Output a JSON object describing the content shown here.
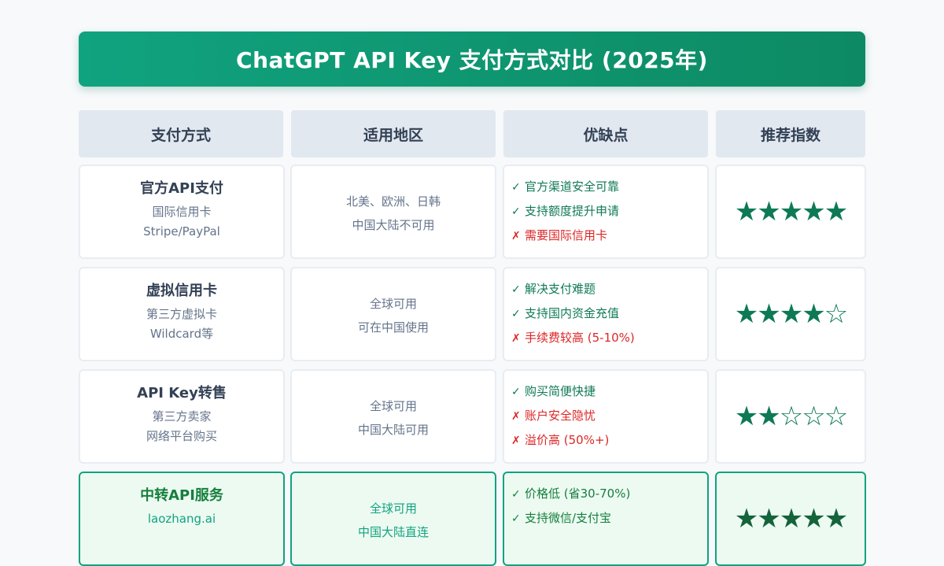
{
  "title": "ChatGPT API Key 支付方式对比 (2025年)",
  "headers": [
    "支付方式",
    "适用地区",
    "优缺点",
    "推荐指数"
  ],
  "rows": [
    {
      "method": {
        "name": "官方API支付",
        "lines": [
          "国际信用卡",
          "Stripe/PayPal"
        ]
      },
      "region": [
        "北美、欧洲、日韩",
        "中国大陆不可用"
      ],
      "points": [
        {
          "type": "pro",
          "mark": "✓",
          "text": "官方渠道安全可靠"
        },
        {
          "type": "pro",
          "mark": "✓",
          "text": "支持额度提升申请"
        },
        {
          "type": "con",
          "mark": "✗",
          "text": "需要国际信用卡"
        }
      ],
      "stars": "★★★★★",
      "highlight": false
    },
    {
      "method": {
        "name": "虚拟信用卡",
        "lines": [
          "第三方虚拟卡",
          "Wildcard等"
        ]
      },
      "region": [
        "全球可用",
        "可在中国使用"
      ],
      "points": [
        {
          "type": "pro",
          "mark": "✓",
          "text": "解决支付难题"
        },
        {
          "type": "pro",
          "mark": "✓",
          "text": "支持国内资金充值"
        },
        {
          "type": "con",
          "mark": "✗",
          "text": "手续费较高 (5-10%)"
        }
      ],
      "stars": "★★★★☆",
      "highlight": false
    },
    {
      "method": {
        "name": "API Key转售",
        "lines": [
          "第三方卖家",
          "网络平台购买"
        ]
      },
      "region": [
        "全球可用",
        "中国大陆可用"
      ],
      "points": [
        {
          "type": "pro",
          "mark": "✓",
          "text": "购买简便快捷"
        },
        {
          "type": "con",
          "mark": "✗",
          "text": "账户安全隐忧"
        },
        {
          "type": "con",
          "mark": "✗",
          "text": "溢价高 (50%+)"
        }
      ],
      "stars": "★★☆☆☆",
      "highlight": false
    },
    {
      "method": {
        "name": "中转API服务",
        "lines": [
          "laozhang.ai"
        ]
      },
      "region": [
        "全球可用",
        "中国大陆直连"
      ],
      "points": [
        {
          "type": "pro",
          "mark": "✓",
          "text": "价格低 (省30-70%)"
        },
        {
          "type": "pro",
          "mark": "✓",
          "text": "支持微信/支付宝"
        }
      ],
      "stars": "★★★★★",
      "highlight": true
    }
  ]
}
